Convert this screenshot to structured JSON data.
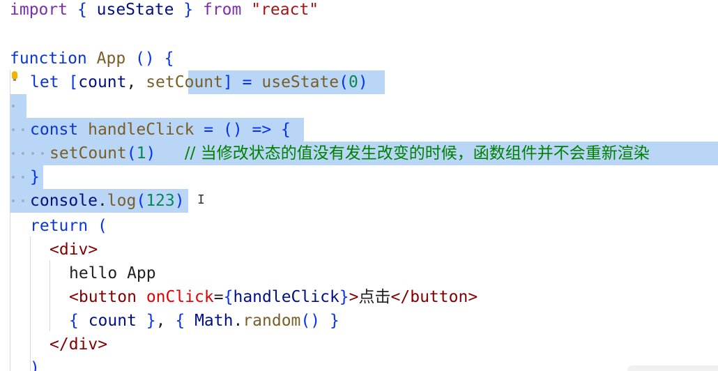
{
  "editor": {
    "lines": [
      {
        "tokens": [
          {
            "t": "import",
            "c": "kw"
          },
          {
            "t": " { ",
            "c": "br"
          },
          {
            "t": "useState",
            "c": "var"
          },
          {
            "t": " } ",
            "c": "br"
          },
          {
            "t": "from",
            "c": "kw"
          },
          {
            "t": " ",
            "c": "txt"
          },
          {
            "t": "\"react\"",
            "c": "str"
          }
        ]
      },
      {
        "tokens": []
      },
      {
        "tokens": [
          {
            "t": "function",
            "c": "kw2"
          },
          {
            "t": " ",
            "c": "txt"
          },
          {
            "t": "App",
            "c": "fn"
          },
          {
            "t": " () {",
            "c": "br"
          }
        ]
      },
      {
        "tokens": [
          {
            "t": "let",
            "c": "kw2"
          },
          {
            "t": " [",
            "c": "br"
          },
          {
            "t": "count",
            "c": "var"
          },
          {
            "t": ", ",
            "c": "txt"
          },
          {
            "t": "setCount",
            "c": "fn"
          },
          {
            "t": "] = ",
            "c": "br"
          },
          {
            "t": "useState",
            "c": "fn"
          },
          {
            "t": "(",
            "c": "br"
          },
          {
            "t": "0",
            "c": "num"
          },
          {
            "t": ")",
            "c": "br"
          }
        ]
      },
      {
        "tokens": []
      },
      {
        "tokens": [
          {
            "t": "const",
            "c": "kw2"
          },
          {
            "t": " ",
            "c": "txt"
          },
          {
            "t": "handleClick",
            "c": "fn"
          },
          {
            "t": " = () => {",
            "c": "br"
          }
        ]
      },
      {
        "tokens": [
          {
            "t": "setCount",
            "c": "fn"
          },
          {
            "t": "(",
            "c": "br"
          },
          {
            "t": "1",
            "c": "num"
          },
          {
            "t": ")",
            "c": "br"
          },
          {
            "t": "   ",
            "c": "txt"
          },
          {
            "t": "// 当修改状态的值没有发生改变的时候，函数组件并不会重新渲染",
            "c": "cmt"
          }
        ]
      },
      {
        "tokens": [
          {
            "t": "}",
            "c": "br"
          }
        ]
      },
      {
        "tokens": [
          {
            "t": "console",
            "c": "var"
          },
          {
            "t": ".",
            "c": "txt"
          },
          {
            "t": "log",
            "c": "fn"
          },
          {
            "t": "(",
            "c": "br"
          },
          {
            "t": "123",
            "c": "num"
          },
          {
            "t": ")",
            "c": "br"
          }
        ]
      },
      {
        "tokens": [
          {
            "t": "return",
            "c": "kw2"
          },
          {
            "t": " (",
            "c": "br"
          }
        ]
      },
      {
        "tokens": [
          {
            "t": "<",
            "c": "tag"
          },
          {
            "t": "div",
            "c": "tag"
          },
          {
            "t": ">",
            "c": "tag"
          }
        ]
      },
      {
        "tokens": [
          {
            "t": "hello App",
            "c": "txt"
          }
        ]
      },
      {
        "tokens": [
          {
            "t": "<",
            "c": "tag"
          },
          {
            "t": "button",
            "c": "tag"
          },
          {
            "t": " ",
            "c": "txt"
          },
          {
            "t": "onClick",
            "c": "attr"
          },
          {
            "t": "=",
            "c": "txt"
          },
          {
            "t": "{",
            "c": "br"
          },
          {
            "t": "handleClick",
            "c": "var"
          },
          {
            "t": "}",
            "c": "br"
          },
          {
            "t": ">",
            "c": "tag"
          },
          {
            "t": "点击",
            "c": "cjk"
          },
          {
            "t": "</",
            "c": "tag"
          },
          {
            "t": "button",
            "c": "tag"
          },
          {
            "t": ">",
            "c": "tag"
          }
        ]
      },
      {
        "tokens": [
          {
            "t": "{ ",
            "c": "br"
          },
          {
            "t": "count",
            "c": "var"
          },
          {
            "t": " }",
            "c": "br"
          },
          {
            "t": ", ",
            "c": "txt"
          },
          {
            "t": "{ ",
            "c": "br"
          },
          {
            "t": "Math",
            "c": "var"
          },
          {
            "t": ".",
            "c": "txt"
          },
          {
            "t": "random",
            "c": "fn"
          },
          {
            "t": "() ",
            "c": "br"
          },
          {
            "t": "}",
            "c": "br"
          }
        ]
      },
      {
        "tokens": [
          {
            "t": "</",
            "c": "tag"
          },
          {
            "t": "div",
            "c": "tag"
          },
          {
            "t": ">",
            "c": "tag"
          }
        ]
      },
      {
        "tokens": [
          {
            "t": ")",
            "c": "br"
          }
        ]
      }
    ],
    "caret_glyph": "I"
  }
}
